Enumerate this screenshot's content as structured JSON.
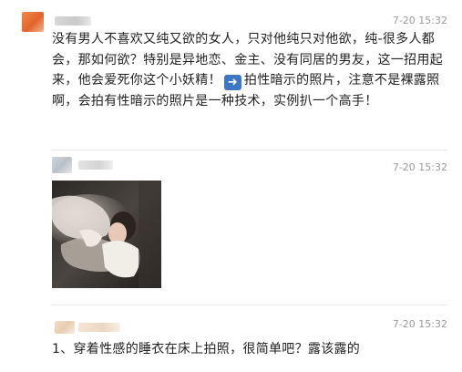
{
  "comments": [
    {
      "time": "7-20 15:32",
      "text_before_icon": "没有男人不喜欢又纯又欲的女人，只对他纯只对他欲，纯-很多人都会，那如何欲？特别是异地恋、金主、没有同居的男友，这一招用起来，他会爱死你这个小妖精！",
      "icon": "right-arrow-icon",
      "text_after_icon": "拍性暗示的照片，注意不是裸露照啊，会拍有性暗示的照片是一种技术，实例扒一个高手！"
    },
    {
      "time": "7-20 15:32"
    },
    {
      "time": "7-20 15:32",
      "text": "1、穿着性感的睡衣在床上拍照，很简单吧？露该露的"
    }
  ],
  "colors": {
    "time": "#9a9a9a",
    "divider": "#e6e6e6",
    "icon_bg": "#3d76c5"
  }
}
